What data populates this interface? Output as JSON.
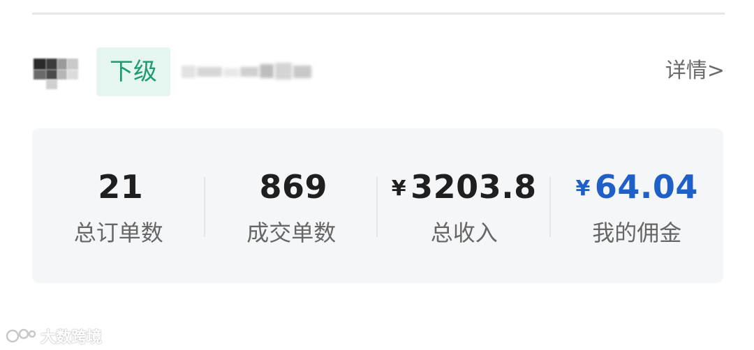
{
  "member": {
    "role_tag": "下级",
    "details_link": "详情>"
  },
  "stats": [
    {
      "value": "21",
      "currency": "",
      "label": "总订单数",
      "accent": false
    },
    {
      "value": "869",
      "currency": "",
      "label": "成交单数",
      "accent": false
    },
    {
      "value": "3203.8",
      "currency": "¥",
      "label": "总收入",
      "accent": false
    },
    {
      "value": "64.04",
      "currency": "¥",
      "label": "我的佣金",
      "accent": true
    }
  ],
  "colors": {
    "tag_background": "#e4f6ef",
    "tag_text": "#1f9a73",
    "commission": "#1f5fc8",
    "card_background": "#f5f6f8"
  },
  "watermark": {
    "text": "大数跨境"
  }
}
